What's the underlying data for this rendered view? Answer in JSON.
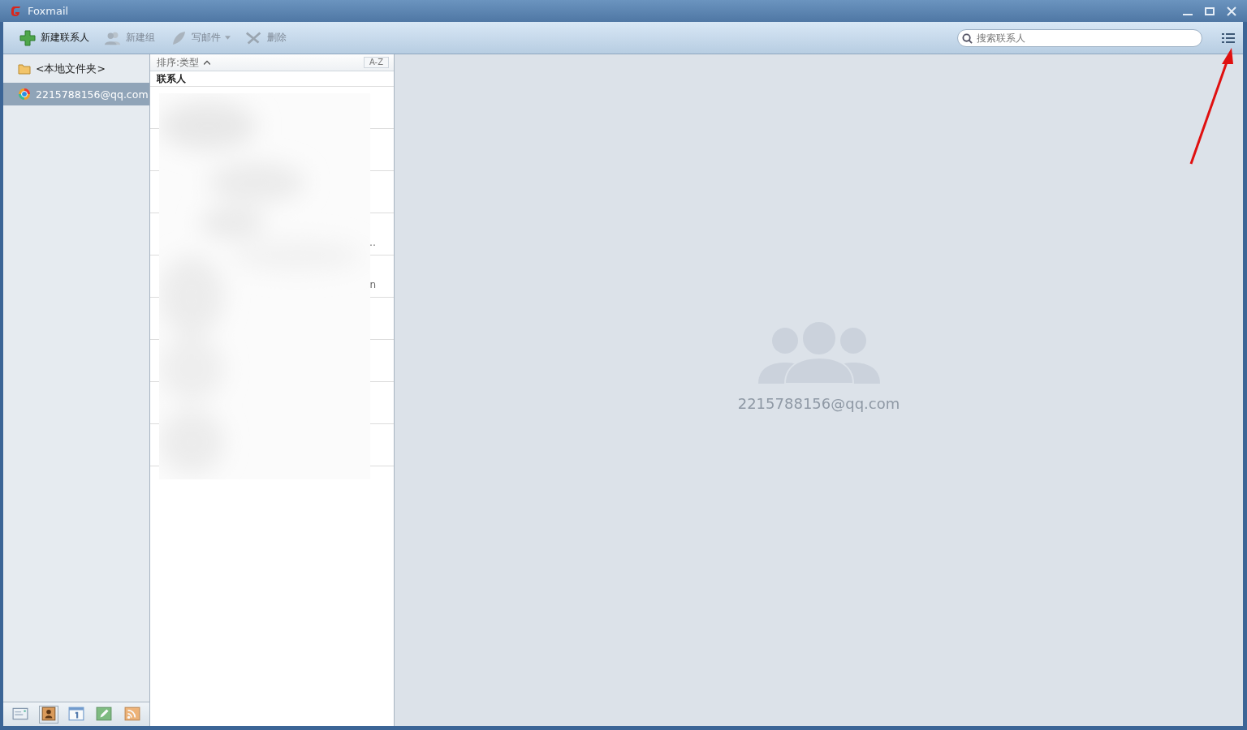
{
  "window": {
    "title": "Foxmail"
  },
  "toolbar": {
    "buttons": [
      {
        "kind": "add",
        "label": "新建联系人",
        "disabled": false
      },
      {
        "kind": "group",
        "label": "新建组",
        "disabled": true
      },
      {
        "kind": "compose",
        "label": "写邮件",
        "disabled": true,
        "dropdown": true
      },
      {
        "kind": "delete",
        "label": "删除",
        "disabled": true
      }
    ],
    "search": {
      "placeholder": "搜索联系人"
    }
  },
  "sidebar": {
    "items": [
      {
        "kind": "folder",
        "label": "<本地文件夹>",
        "selected": false
      },
      {
        "kind": "account",
        "label": "2215788156@qq.com",
        "selected": true
      }
    ]
  },
  "nav": [
    {
      "kind": "mail",
      "selected": false
    },
    {
      "kind": "contacts",
      "selected": true
    },
    {
      "kind": "calendar",
      "selected": false
    },
    {
      "kind": "notes",
      "selected": false
    },
    {
      "kind": "feeds",
      "selected": false
    }
  ],
  "contact_list": {
    "sort_label": "排序:类型",
    "sort_button": "A-Z",
    "group_header": "联系人",
    "rows": [
      {
        "tail": ""
      },
      {
        "tail": ""
      },
      {
        "tail": ""
      },
      {
        "tail": "…"
      },
      {
        "tail": "n"
      },
      {
        "tail": ""
      },
      {
        "tail": ""
      },
      {
        "tail": ""
      },
      {
        "tail": ""
      }
    ]
  },
  "detail": {
    "account": "2215788156@qq.com"
  }
}
